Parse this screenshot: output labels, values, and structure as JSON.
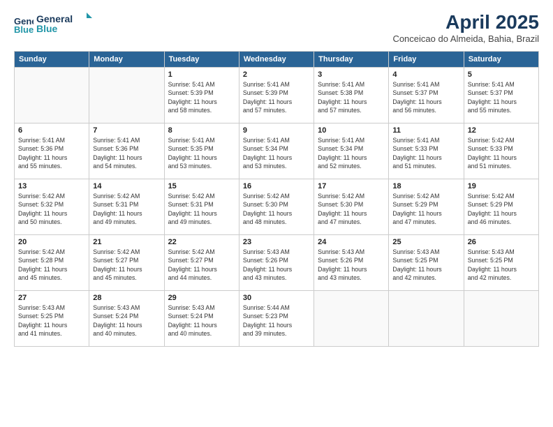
{
  "header": {
    "logo_line1": "General",
    "logo_line2": "Blue",
    "month_year": "April 2025",
    "location": "Conceicao do Almeida, Bahia, Brazil"
  },
  "weekdays": [
    "Sunday",
    "Monday",
    "Tuesday",
    "Wednesday",
    "Thursday",
    "Friday",
    "Saturday"
  ],
  "weeks": [
    [
      {
        "day": "",
        "info": ""
      },
      {
        "day": "",
        "info": ""
      },
      {
        "day": "1",
        "info": "Sunrise: 5:41 AM\nSunset: 5:39 PM\nDaylight: 11 hours\nand 58 minutes."
      },
      {
        "day": "2",
        "info": "Sunrise: 5:41 AM\nSunset: 5:39 PM\nDaylight: 11 hours\nand 57 minutes."
      },
      {
        "day": "3",
        "info": "Sunrise: 5:41 AM\nSunset: 5:38 PM\nDaylight: 11 hours\nand 57 minutes."
      },
      {
        "day": "4",
        "info": "Sunrise: 5:41 AM\nSunset: 5:37 PM\nDaylight: 11 hours\nand 56 minutes."
      },
      {
        "day": "5",
        "info": "Sunrise: 5:41 AM\nSunset: 5:37 PM\nDaylight: 11 hours\nand 55 minutes."
      }
    ],
    [
      {
        "day": "6",
        "info": "Sunrise: 5:41 AM\nSunset: 5:36 PM\nDaylight: 11 hours\nand 55 minutes."
      },
      {
        "day": "7",
        "info": "Sunrise: 5:41 AM\nSunset: 5:36 PM\nDaylight: 11 hours\nand 54 minutes."
      },
      {
        "day": "8",
        "info": "Sunrise: 5:41 AM\nSunset: 5:35 PM\nDaylight: 11 hours\nand 53 minutes."
      },
      {
        "day": "9",
        "info": "Sunrise: 5:41 AM\nSunset: 5:34 PM\nDaylight: 11 hours\nand 53 minutes."
      },
      {
        "day": "10",
        "info": "Sunrise: 5:41 AM\nSunset: 5:34 PM\nDaylight: 11 hours\nand 52 minutes."
      },
      {
        "day": "11",
        "info": "Sunrise: 5:41 AM\nSunset: 5:33 PM\nDaylight: 11 hours\nand 51 minutes."
      },
      {
        "day": "12",
        "info": "Sunrise: 5:42 AM\nSunset: 5:33 PM\nDaylight: 11 hours\nand 51 minutes."
      }
    ],
    [
      {
        "day": "13",
        "info": "Sunrise: 5:42 AM\nSunset: 5:32 PM\nDaylight: 11 hours\nand 50 minutes."
      },
      {
        "day": "14",
        "info": "Sunrise: 5:42 AM\nSunset: 5:31 PM\nDaylight: 11 hours\nand 49 minutes."
      },
      {
        "day": "15",
        "info": "Sunrise: 5:42 AM\nSunset: 5:31 PM\nDaylight: 11 hours\nand 49 minutes."
      },
      {
        "day": "16",
        "info": "Sunrise: 5:42 AM\nSunset: 5:30 PM\nDaylight: 11 hours\nand 48 minutes."
      },
      {
        "day": "17",
        "info": "Sunrise: 5:42 AM\nSunset: 5:30 PM\nDaylight: 11 hours\nand 47 minutes."
      },
      {
        "day": "18",
        "info": "Sunrise: 5:42 AM\nSunset: 5:29 PM\nDaylight: 11 hours\nand 47 minutes."
      },
      {
        "day": "19",
        "info": "Sunrise: 5:42 AM\nSunset: 5:29 PM\nDaylight: 11 hours\nand 46 minutes."
      }
    ],
    [
      {
        "day": "20",
        "info": "Sunrise: 5:42 AM\nSunset: 5:28 PM\nDaylight: 11 hours\nand 45 minutes."
      },
      {
        "day": "21",
        "info": "Sunrise: 5:42 AM\nSunset: 5:27 PM\nDaylight: 11 hours\nand 45 minutes."
      },
      {
        "day": "22",
        "info": "Sunrise: 5:42 AM\nSunset: 5:27 PM\nDaylight: 11 hours\nand 44 minutes."
      },
      {
        "day": "23",
        "info": "Sunrise: 5:43 AM\nSunset: 5:26 PM\nDaylight: 11 hours\nand 43 minutes."
      },
      {
        "day": "24",
        "info": "Sunrise: 5:43 AM\nSunset: 5:26 PM\nDaylight: 11 hours\nand 43 minutes."
      },
      {
        "day": "25",
        "info": "Sunrise: 5:43 AM\nSunset: 5:25 PM\nDaylight: 11 hours\nand 42 minutes."
      },
      {
        "day": "26",
        "info": "Sunrise: 5:43 AM\nSunset: 5:25 PM\nDaylight: 11 hours\nand 42 minutes."
      }
    ],
    [
      {
        "day": "27",
        "info": "Sunrise: 5:43 AM\nSunset: 5:25 PM\nDaylight: 11 hours\nand 41 minutes."
      },
      {
        "day": "28",
        "info": "Sunrise: 5:43 AM\nSunset: 5:24 PM\nDaylight: 11 hours\nand 40 minutes."
      },
      {
        "day": "29",
        "info": "Sunrise: 5:43 AM\nSunset: 5:24 PM\nDaylight: 11 hours\nand 40 minutes."
      },
      {
        "day": "30",
        "info": "Sunrise: 5:44 AM\nSunset: 5:23 PM\nDaylight: 11 hours\nand 39 minutes."
      },
      {
        "day": "",
        "info": ""
      },
      {
        "day": "",
        "info": ""
      },
      {
        "day": "",
        "info": ""
      }
    ]
  ]
}
